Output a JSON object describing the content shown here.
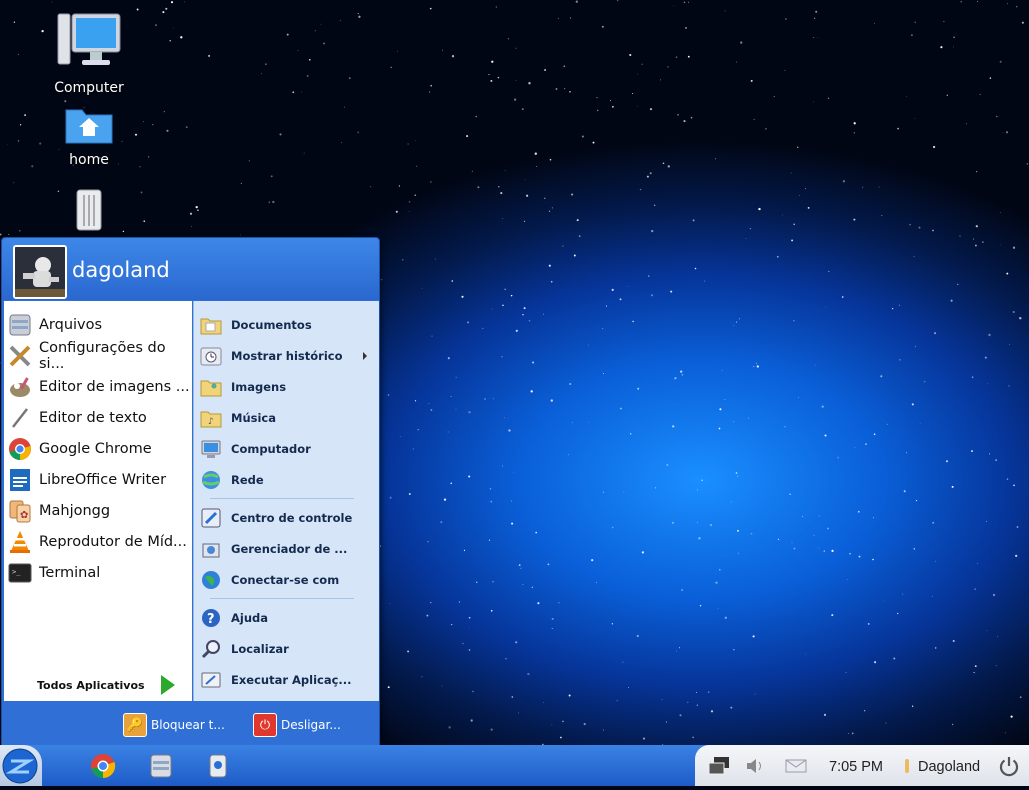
{
  "desktop": {
    "icons": [
      {
        "label": "Computer",
        "icon": "computer-monitor-icon"
      },
      {
        "label": "home",
        "icon": "home-folder-icon"
      },
      {
        "label": "",
        "icon": "trash-icon"
      }
    ]
  },
  "start_menu": {
    "username": "dagoland",
    "apps": [
      {
        "label": "Arquivos",
        "icon": "file-manager-icon"
      },
      {
        "label": "Configurações do si...",
        "icon": "settings-tools-icon"
      },
      {
        "label": "Editor de imagens ...",
        "icon": "gimp-icon"
      },
      {
        "label": "Editor de texto",
        "icon": "text-editor-icon"
      },
      {
        "label": "Google Chrome",
        "icon": "chrome-icon"
      },
      {
        "label": "LibreOffice Writer",
        "icon": "libreoffice-writer-icon"
      },
      {
        "label": "Mahjongg",
        "icon": "mahjongg-icon"
      },
      {
        "label": "Reprodutor de Míd...",
        "icon": "vlc-icon"
      },
      {
        "label": "Terminal",
        "icon": "terminal-icon"
      }
    ],
    "all_apps_label": "Todos Aplicativos",
    "places": [
      {
        "label": "Documentos",
        "icon": "documents-folder-icon"
      },
      {
        "label": "Mostrar histórico",
        "icon": "history-icon",
        "submenu": true
      },
      {
        "label": "Imagens",
        "icon": "pictures-folder-icon"
      },
      {
        "label": "Música",
        "icon": "music-folder-icon"
      },
      {
        "label": "Computador",
        "icon": "computer-icon"
      },
      {
        "label": "Rede",
        "icon": "network-icon"
      }
    ],
    "system": [
      {
        "label": "Centro de controle",
        "icon": "control-center-icon"
      },
      {
        "label": "Gerenciador de ...",
        "icon": "package-manager-icon"
      },
      {
        "label": "Conectar-se com",
        "icon": "connect-globe-icon"
      }
    ],
    "tools": [
      {
        "label": "Ajuda",
        "icon": "help-icon"
      },
      {
        "label": "Localizar",
        "icon": "search-icon"
      },
      {
        "label": "Executar Aplicaç...",
        "icon": "run-application-icon"
      }
    ],
    "footer": {
      "lock_label": "Bloquear t...",
      "shutdown_label": "Desligar..."
    }
  },
  "taskbar": {
    "launchers": [
      "chrome-icon",
      "file-manager-icon",
      "screenshot-app-icon"
    ],
    "clock": "7:05 PM",
    "user": "Dagoland"
  },
  "colors": {
    "menu_blue": "#2f6fd6",
    "places_bg": "#d6e5f7",
    "taskbar_blue": "#2a6fd6"
  }
}
